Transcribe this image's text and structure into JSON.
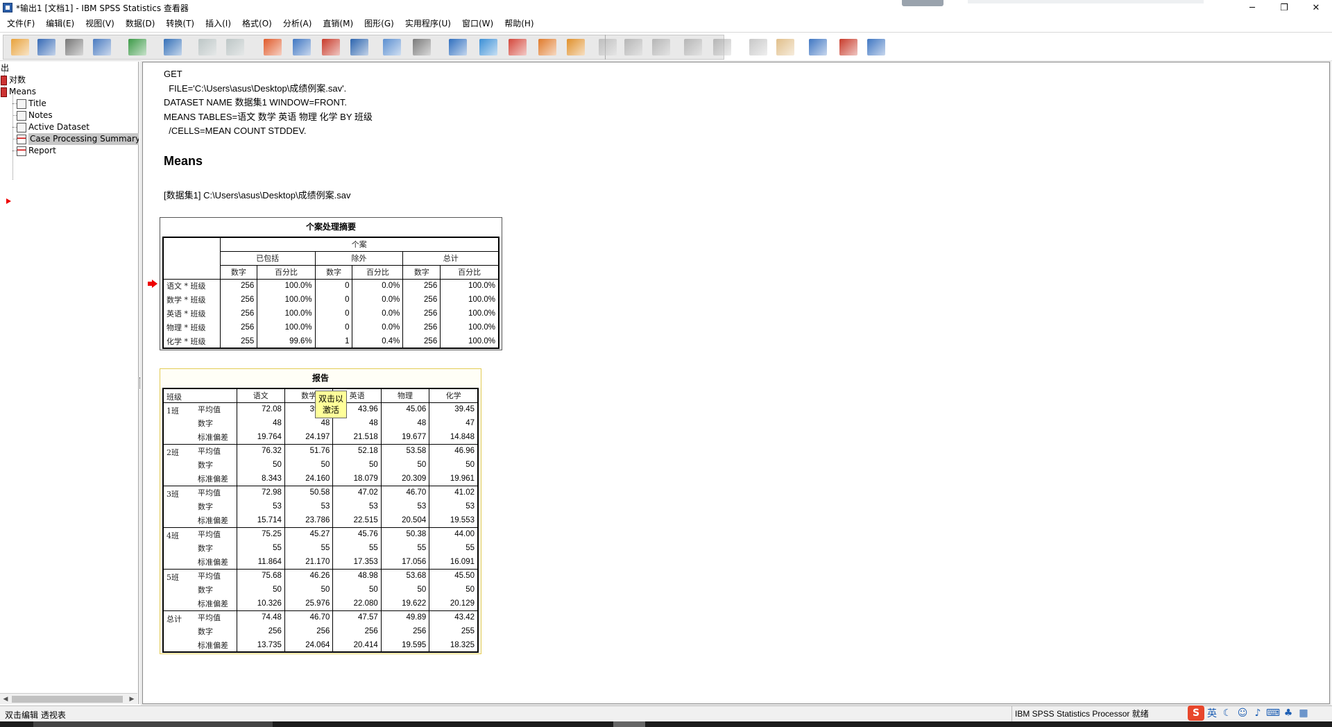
{
  "window": {
    "title": "*输出1 [文档1] - IBM SPSS Statistics 查看器",
    "minimize": "─",
    "maximize": "❐",
    "close": "✕"
  },
  "menu": [
    "文件(F)",
    "编辑(E)",
    "视图(V)",
    "数据(D)",
    "转换(T)",
    "插入(I)",
    "格式(O)",
    "分析(A)",
    "直销(M)",
    "图形(G)",
    "实用程序(U)",
    "窗口(W)",
    "帮助(H)"
  ],
  "toolbar": {
    "icons": [
      "open-folder-icon",
      "save-icon",
      "print-icon",
      "print-preview-icon",
      "export-icon",
      "goto-data-icon",
      "undo-icon",
      "redo-icon",
      "goto-case-icon",
      "goto-variable-icon",
      "insert-cases-icon",
      "variables-icon",
      "select-cases-icon",
      "value-labels-icon",
      "weight-cases-icon",
      "split-file-icon",
      "insert-output-icon",
      "insert-chart-icon",
      "insert-text-icon",
      "stop-icon",
      "promote-icon",
      "demote-icon",
      "expand-icon",
      "collapse-icon",
      "show-icon",
      "hide-icon",
      "insert-heading-icon",
      "insert-title-icon",
      "insert-new-text-icon"
    ],
    "colors": {
      "group_bg": "#e9e9e9"
    }
  },
  "outline": {
    "root": "出",
    "log": "对数",
    "means": "Means",
    "children": [
      "Title",
      "Notes",
      "Active Dataset",
      "Case Processing Summary",
      "Report"
    ],
    "selected": "Case Processing Summary"
  },
  "syntax": {
    "lines": [
      "GET",
      "  FILE='C:\\Users\\asus\\Desktop\\成绩例案.sav'.",
      "DATASET NAME 数据集1 WINDOW=FRONT.",
      "MEANS TABLES=语文 数学 英语 物理 化学 BY 班级",
      "  /CELLS=MEAN COUNT STDDEV."
    ]
  },
  "heading": "Means",
  "dataset_line": "[数据集1] C:\\Users\\asus\\Desktop\\成绩例案.sav",
  "case_summary": {
    "title": "个案处理摘要",
    "top_header": "个案",
    "groups": [
      "已包括",
      "除外",
      "总计"
    ],
    "sub_headers": [
      "数字",
      "百分比",
      "数字",
      "百分比",
      "数字",
      "百分比"
    ],
    "rows": [
      {
        "label": "语文 * 班级",
        "cells": [
          "256",
          "100.0%",
          "0",
          "0.0%",
          "256",
          "100.0%"
        ]
      },
      {
        "label": "数学 * 班级",
        "cells": [
          "256",
          "100.0%",
          "0",
          "0.0%",
          "256",
          "100.0%"
        ]
      },
      {
        "label": "英语 * 班级",
        "cells": [
          "256",
          "100.0%",
          "0",
          "0.0%",
          "256",
          "100.0%"
        ]
      },
      {
        "label": "物理 * 班级",
        "cells": [
          "256",
          "100.0%",
          "0",
          "0.0%",
          "256",
          "100.0%"
        ]
      },
      {
        "label": "化学 * 班级",
        "cells": [
          "255",
          "99.6%",
          "1",
          "0.4%",
          "256",
          "100.0%"
        ]
      }
    ]
  },
  "report": {
    "title": "报告",
    "corner": "班级",
    "columns": [
      "语文",
      "数学",
      "英语",
      "物理",
      "化学"
    ],
    "stats": [
      "平均值",
      "数字",
      "标准偏差"
    ],
    "groups": [
      {
        "name": "1班",
        "rows": [
          [
            "72.08",
            "39.19",
            "43.96",
            "45.06",
            "39.45"
          ],
          [
            "48",
            "48",
            "48",
            "48",
            "47"
          ],
          [
            "19.764",
            "24.197",
            "21.518",
            "19.677",
            "14.848"
          ]
        ]
      },
      {
        "name": "2班",
        "rows": [
          [
            "76.32",
            "51.76",
            "52.18",
            "53.58",
            "46.96"
          ],
          [
            "50",
            "50",
            "50",
            "50",
            "50"
          ],
          [
            "8.343",
            "24.160",
            "18.079",
            "20.309",
            "19.961"
          ]
        ]
      },
      {
        "name": "3班",
        "rows": [
          [
            "72.98",
            "50.58",
            "47.02",
            "46.70",
            "41.02"
          ],
          [
            "53",
            "53",
            "53",
            "53",
            "53"
          ],
          [
            "15.714",
            "23.786",
            "22.515",
            "20.504",
            "19.553"
          ]
        ]
      },
      {
        "name": "4班",
        "rows": [
          [
            "75.25",
            "45.27",
            "45.76",
            "50.38",
            "44.00"
          ],
          [
            "55",
            "55",
            "55",
            "55",
            "55"
          ],
          [
            "11.864",
            "21.170",
            "17.353",
            "17.056",
            "16.091"
          ]
        ]
      },
      {
        "name": "5班",
        "rows": [
          [
            "75.68",
            "46.26",
            "48.98",
            "53.68",
            "45.50"
          ],
          [
            "50",
            "50",
            "50",
            "50",
            "50"
          ],
          [
            "10.326",
            "25.976",
            "22.080",
            "19.622",
            "20.129"
          ]
        ]
      },
      {
        "name": "总计",
        "rows": [
          [
            "74.48",
            "46.70",
            "47.57",
            "49.89",
            "43.42"
          ],
          [
            "256",
            "256",
            "256",
            "256",
            "255"
          ],
          [
            "13.735",
            "24.064",
            "20.414",
            "19.595",
            "18.325"
          ]
        ]
      }
    ]
  },
  "tooltip": {
    "line1": "双击以",
    "line2": "激活"
  },
  "status": {
    "left": "双击编辑 透视表",
    "right": "IBM SPSS Statistics Processor 就绪"
  },
  "tray": {
    "ime": "S",
    "lang": "英",
    "icons": [
      "moon-icon",
      "smiley-icon",
      "mic-icon",
      "keyboard-icon",
      "shirt-icon",
      "grid-icon"
    ]
  }
}
